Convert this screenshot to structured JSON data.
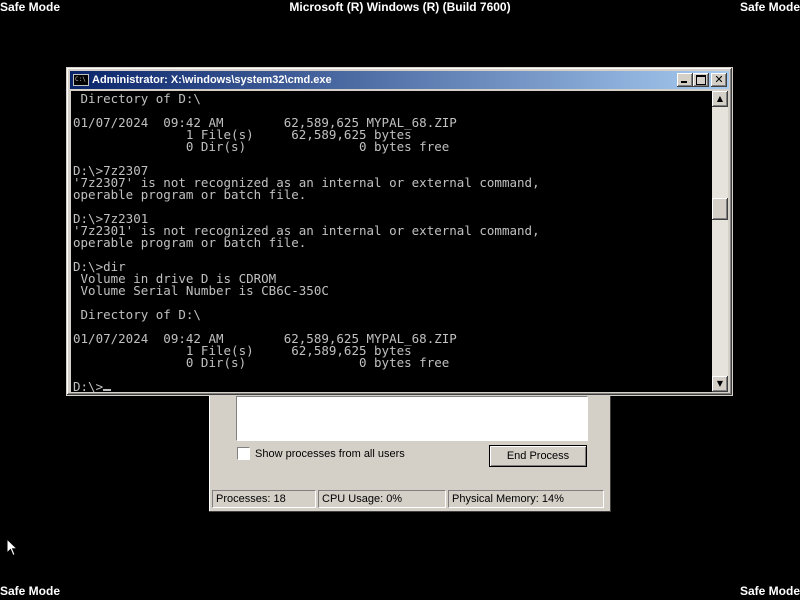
{
  "screen": {
    "safe_mode_label": "Safe Mode",
    "top_title": "Microsoft (R) Windows (R) (Build 7600)"
  },
  "task_manager": {
    "show_all_users_label": "Show processes from all users",
    "end_process_label": "End Process",
    "status": {
      "processes": "Processes: 18",
      "cpu_usage": "CPU Usage: 0%",
      "physical_memory": "Physical Memory: 14%"
    }
  },
  "cmd_window": {
    "title": "Administrator: X:\\windows\\system32\\cmd.exe",
    "icon": "console-icon",
    "buttons": {
      "minimize_icon": "minimize-icon",
      "maximize_icon": "maximize-icon",
      "close_icon": "close-icon"
    },
    "scroll_thumb_position": 0.37,
    "console_lines": [
      " Directory of D:\\",
      "",
      "01/07/2024  09:42 AM        62,589,625 MYPAL_68.ZIP",
      "               1 File(s)     62,589,625 bytes",
      "               0 Dir(s)               0 bytes free",
      "",
      "D:\\>7z2307",
      "'7z2307' is not recognized as an internal or external command,",
      "operable program or batch file.",
      "",
      "D:\\>7z2301",
      "'7z2301' is not recognized as an internal or external command,",
      "operable program or batch file.",
      "",
      "D:\\>dir",
      " Volume in drive D is CDROM",
      " Volume Serial Number is CB6C-350C",
      "",
      " Directory of D:\\",
      "",
      "01/07/2024  09:42 AM        62,589,625 MYPAL_68.ZIP",
      "               1 File(s)     62,589,625 bytes",
      "               0 Dir(s)               0 bytes free",
      ""
    ],
    "prompt": "D:\\>"
  }
}
